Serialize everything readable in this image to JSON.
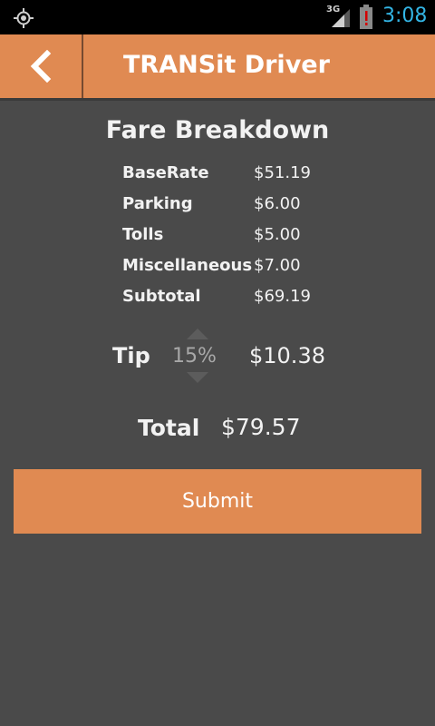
{
  "status_bar": {
    "network": "3G",
    "time": "3:08",
    "icons": [
      "gps-icon",
      "signal-icon",
      "battery-alert-icon"
    ],
    "clock_color": "#33b5e5"
  },
  "app_bar": {
    "title": "TRANSit Driver",
    "back_icon": "chevron-left-icon",
    "color": "#e08a52"
  },
  "fare": {
    "title": "Fare Breakdown",
    "items": [
      {
        "label": "BaseRate",
        "value": "$51.19"
      },
      {
        "label": "Parking",
        "value": "$6.00"
      },
      {
        "label": "Tolls",
        "value": "$5.00"
      },
      {
        "label": "Miscellaneous",
        "value": "$7.00"
      },
      {
        "label": "Subtotal",
        "value": "$69.19"
      }
    ]
  },
  "tip": {
    "label": "Tip",
    "percent": "15%",
    "amount": "$10.38"
  },
  "total": {
    "label": "Total",
    "value": "$79.57"
  },
  "submit": {
    "label": "Submit",
    "color": "#e08a52"
  }
}
